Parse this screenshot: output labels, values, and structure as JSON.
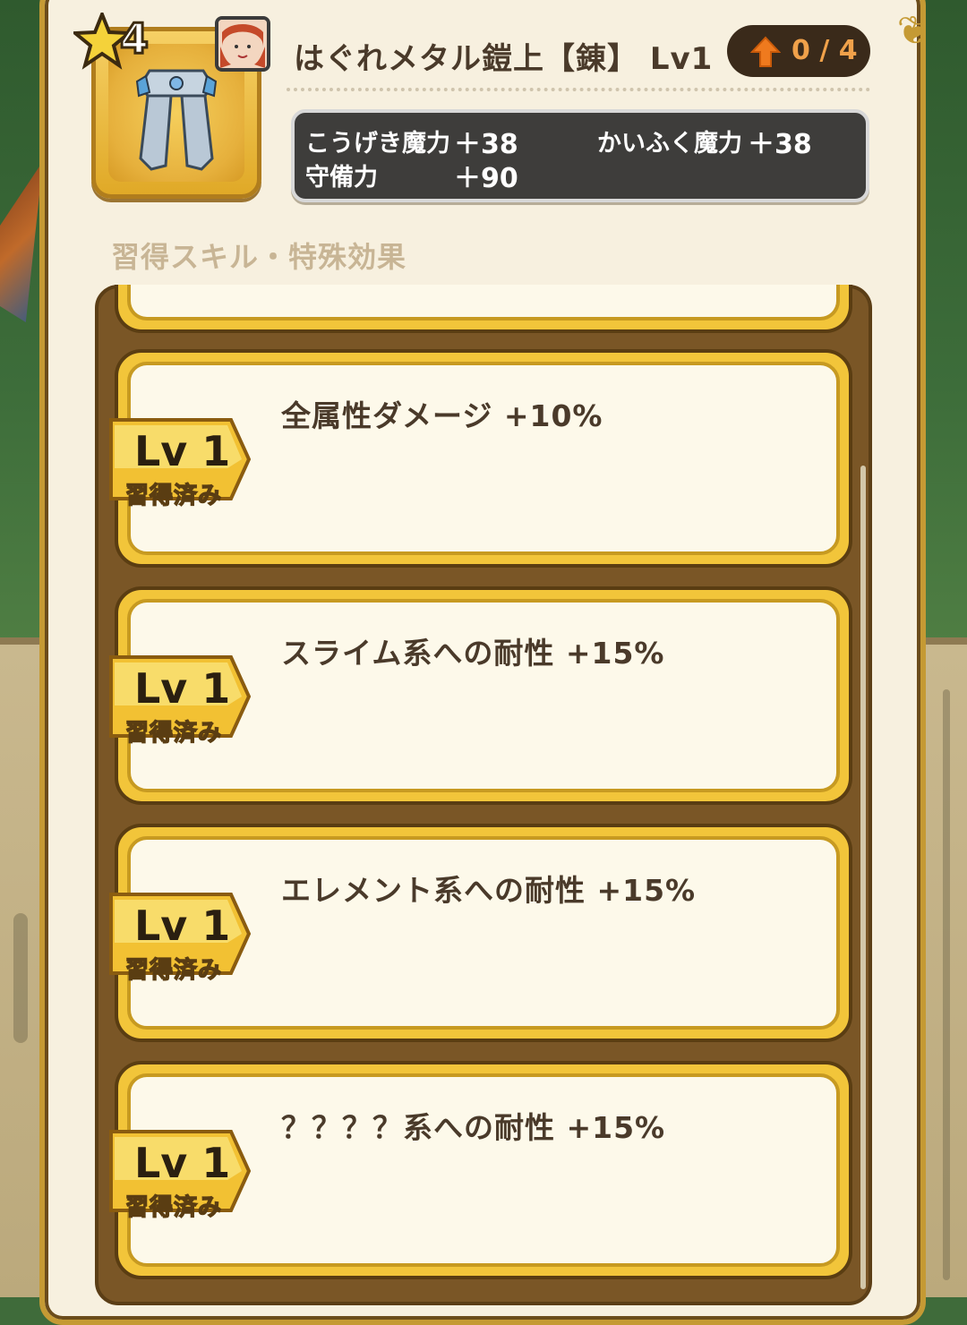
{
  "item": {
    "rarity_stars": "4",
    "name": "はぐれメタル鎧上【錬】 Lv1",
    "upgrade": "0 / 4"
  },
  "stats": [
    {
      "label": "こうげき魔力",
      "value": "＋38"
    },
    {
      "label": "かいふく魔力",
      "value": "＋38"
    },
    {
      "label": "守備力",
      "value": "＋90"
    }
  ],
  "section_title": "習得スキル・特殊効果",
  "skills": [
    {
      "level": "Lv 1",
      "status": "習得済み",
      "text": "全属性ダメージ +10%"
    },
    {
      "level": "Lv 1",
      "status": "習得済み",
      "text": "スライム系への耐性 +15%"
    },
    {
      "level": "Lv 1",
      "status": "習得済み",
      "text": "エレメント系への耐性 +15%"
    },
    {
      "level": "Lv 1",
      "status": "習得済み",
      "text": "？？？？系への耐性 +15%"
    }
  ]
}
